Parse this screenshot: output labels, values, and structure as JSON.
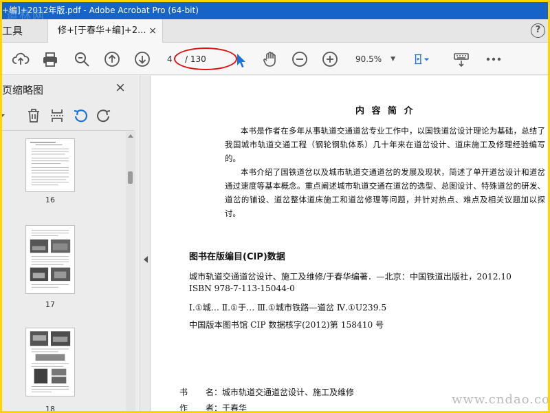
{
  "window": {
    "title": "+编]+2012年版.pdf - Adobe Acrobat Pro (64-bit)",
    "watermark_top": "道林网"
  },
  "tabs": {
    "tools_label": "工具",
    "doc_tab_label": "修+[于春华+编]+2...",
    "close_glyph": "×",
    "help_glyph": "?"
  },
  "toolbar": {
    "current_page": "4",
    "total_pages": "/ 130",
    "zoom": "90.5%",
    "icons": [
      "cloud-upload-icon",
      "print-icon",
      "zoom-search-icon",
      "page-up-icon",
      "page-down-icon",
      "select-cursor-icon",
      "hand-icon",
      "zoom-out-icon",
      "zoom-in-icon",
      "fit-page-icon",
      "keyboard-icon",
      "more-icon"
    ],
    "accent": "#1a73d9",
    "highlight_color": "#e01010"
  },
  "sidebar": {
    "title": "页缩略图",
    "close_glyph": "×",
    "thumbnails": [
      {
        "label": "16"
      },
      {
        "label": "17"
      },
      {
        "label": "18"
      }
    ]
  },
  "document": {
    "heading": "内 容 简 介",
    "paragraphs": [
      "本书是作者在多年从事轨道交通道岔专业工作中，以国铁道岔设计理论为基础，总结了我国城市轨道交通工程（钢轮钢轨体系）几十年来在道岔设计、道床施工及修理经验编写的。",
      "本书介绍了国铁道岔以及城市轨道交通道岔的发展及现状，简述了单开道岔设计和道岔通过速度等基本概念。重点阐述城市轨道交通在道岔的选型、总图设计、特殊道岔的研发、道岔的铺设、道岔整体道床施工和道岔修理等问题，并针对热点、难点及相关议题加以探讨。"
    ],
    "cip_title": "图书在版编目(CIP)数据",
    "cip_lines": [
      "城市轨道交通道岔设计、施工及维修/于春华编著．—北京：中国铁道出版社，2012.10",
      "ISBN 978-7-113-15044-0",
      "Ⅰ.①城…  Ⅱ.①于…  Ⅲ.①城市铁路—道岔   Ⅳ.①U239.5",
      "中国版本图书馆 CIP 数据核字(2012)第 158410 号"
    ],
    "meta": [
      {
        "key": "书",
        "value": "名：城市轨道交通道岔设计、施工及维修"
      },
      {
        "key": "作",
        "value": "者：于春华"
      }
    ]
  },
  "footer": {
    "watermark": "www.cndao.com"
  }
}
